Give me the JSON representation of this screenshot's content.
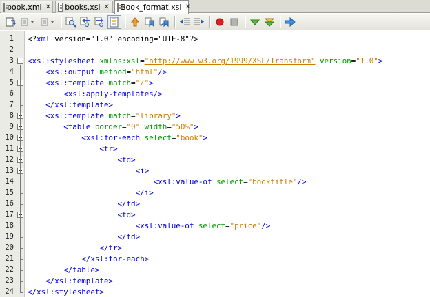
{
  "tabs": [
    {
      "label": "book.xml",
      "active": false
    },
    {
      "label": "books.xsl",
      "active": false
    },
    {
      "label": "Book_format.xsl",
      "active": true
    }
  ],
  "toolbar": {
    "buttons": [
      "last-edit-icon",
      "back-icon",
      "forward-icon",
      "find-icon",
      "find-previous-icon",
      "find-next-icon",
      "toggle-highlight-icon",
      "previous-bookmark-icon",
      "next-bookmark-icon",
      "toggle-bookmark-icon",
      "shift-left-icon",
      "shift-right-icon",
      "start-macro-icon",
      "stop-macro-icon",
      "check-xml-icon",
      "validate-xml-icon",
      "xsl-transform-icon"
    ]
  },
  "colors": {
    "tag": "#0000e6",
    "attribute": "#009900",
    "value": "#ce7b00"
  },
  "editor": {
    "lines": [
      {
        "n": "1",
        "indent": "",
        "tokens": [
          [
            "pi",
            "<?"
          ],
          [
            "tag",
            "xml"
          ],
          [
            "pi",
            " version=\"1.0\" encoding=\"UTF-8\"?>"
          ]
        ]
      },
      {
        "n": "2",
        "indent": "",
        "tokens": []
      },
      {
        "n": "3",
        "indent": "",
        "tokens": [
          [
            "tag",
            "<xsl:stylesheet"
          ],
          [
            "txt",
            " "
          ],
          [
            "atr",
            "xmlns:xsl"
          ],
          [
            "txt",
            "="
          ],
          [
            "url",
            "\"http://www.w3.org/1999/XSL/Transform\""
          ],
          [
            "txt",
            " "
          ],
          [
            "atr",
            "version"
          ],
          [
            "txt",
            "="
          ],
          [
            "val",
            "\"1.0\""
          ],
          [
            "tag",
            ">"
          ]
        ]
      },
      {
        "n": "4",
        "indent": "    ",
        "tokens": [
          [
            "tag",
            "<xsl:output"
          ],
          [
            "txt",
            " "
          ],
          [
            "atr",
            "method"
          ],
          [
            "txt",
            "="
          ],
          [
            "val",
            "\"html\""
          ],
          [
            "tag",
            "/>"
          ]
        ]
      },
      {
        "n": "5",
        "indent": "    ",
        "tokens": [
          [
            "tag",
            "<xsl:template"
          ],
          [
            "txt",
            " "
          ],
          [
            "atr",
            "match"
          ],
          [
            "txt",
            "="
          ],
          [
            "val",
            "\"/\""
          ],
          [
            "tag",
            ">"
          ]
        ]
      },
      {
        "n": "6",
        "indent": "        ",
        "tokens": [
          [
            "tag",
            "<xsl:apply-templates/>"
          ]
        ]
      },
      {
        "n": "7",
        "indent": "    ",
        "tokens": [
          [
            "tag",
            "</xsl:template>"
          ]
        ]
      },
      {
        "n": "8",
        "indent": "    ",
        "tokens": [
          [
            "tag",
            "<xsl:template"
          ],
          [
            "txt",
            " "
          ],
          [
            "atr",
            "match"
          ],
          [
            "txt",
            "="
          ],
          [
            "val",
            "\"library\""
          ],
          [
            "tag",
            ">"
          ]
        ]
      },
      {
        "n": "9",
        "indent": "        ",
        "tokens": [
          [
            "tag",
            "<table"
          ],
          [
            "txt",
            " "
          ],
          [
            "atr",
            "border"
          ],
          [
            "txt",
            "="
          ],
          [
            "val",
            "\"0\""
          ],
          [
            "txt",
            " "
          ],
          [
            "atr",
            "width"
          ],
          [
            "txt",
            "="
          ],
          [
            "val",
            "\"50%\""
          ],
          [
            "tag",
            ">"
          ]
        ]
      },
      {
        "n": "10",
        "indent": "            ",
        "tokens": [
          [
            "tag",
            "<xsl:for-each"
          ],
          [
            "txt",
            " "
          ],
          [
            "atr",
            "select"
          ],
          [
            "txt",
            "="
          ],
          [
            "val",
            "\"book\""
          ],
          [
            "tag",
            ">"
          ]
        ]
      },
      {
        "n": "11",
        "indent": "                ",
        "tokens": [
          [
            "tag",
            "<tr>"
          ]
        ]
      },
      {
        "n": "12",
        "indent": "                    ",
        "tokens": [
          [
            "tag",
            "<td>"
          ]
        ]
      },
      {
        "n": "13",
        "indent": "                        ",
        "tokens": [
          [
            "tag",
            "<i>"
          ]
        ]
      },
      {
        "n": "14",
        "indent": "                            ",
        "tokens": [
          [
            "tag",
            "<xsl:value-of"
          ],
          [
            "txt",
            " "
          ],
          [
            "atr",
            "select"
          ],
          [
            "txt",
            "="
          ],
          [
            "val",
            "\"booktitle\""
          ],
          [
            "tag",
            "/>"
          ]
        ]
      },
      {
        "n": "15",
        "indent": "                        ",
        "tokens": [
          [
            "tag",
            "</i>"
          ]
        ]
      },
      {
        "n": "16",
        "indent": "                    ",
        "tokens": [
          [
            "tag",
            "</td>"
          ]
        ]
      },
      {
        "n": "17",
        "indent": "                    ",
        "tokens": [
          [
            "tag",
            "<td>"
          ]
        ]
      },
      {
        "n": "18",
        "indent": "                        ",
        "tokens": [
          [
            "tag",
            "<xsl:value-of"
          ],
          [
            "txt",
            " "
          ],
          [
            "atr",
            "select"
          ],
          [
            "txt",
            "="
          ],
          [
            "val",
            "\"price\""
          ],
          [
            "tag",
            "/>"
          ]
        ]
      },
      {
        "n": "19",
        "indent": "                    ",
        "tokens": [
          [
            "tag",
            "</td>"
          ]
        ]
      },
      {
        "n": "20",
        "indent": "                ",
        "tokens": [
          [
            "tag",
            "</tr>"
          ]
        ]
      },
      {
        "n": "21",
        "indent": "            ",
        "tokens": [
          [
            "tag",
            "</xsl:for-each>"
          ]
        ]
      },
      {
        "n": "22",
        "indent": "        ",
        "tokens": [
          [
            "tag",
            "</table>"
          ]
        ]
      },
      {
        "n": "23",
        "indent": "    ",
        "tokens": [
          [
            "tag",
            "</xsl:template>"
          ]
        ]
      },
      {
        "n": "24",
        "indent": "",
        "tokens": [
          [
            "tag",
            "</xsl:stylesheet>"
          ]
        ]
      }
    ]
  }
}
